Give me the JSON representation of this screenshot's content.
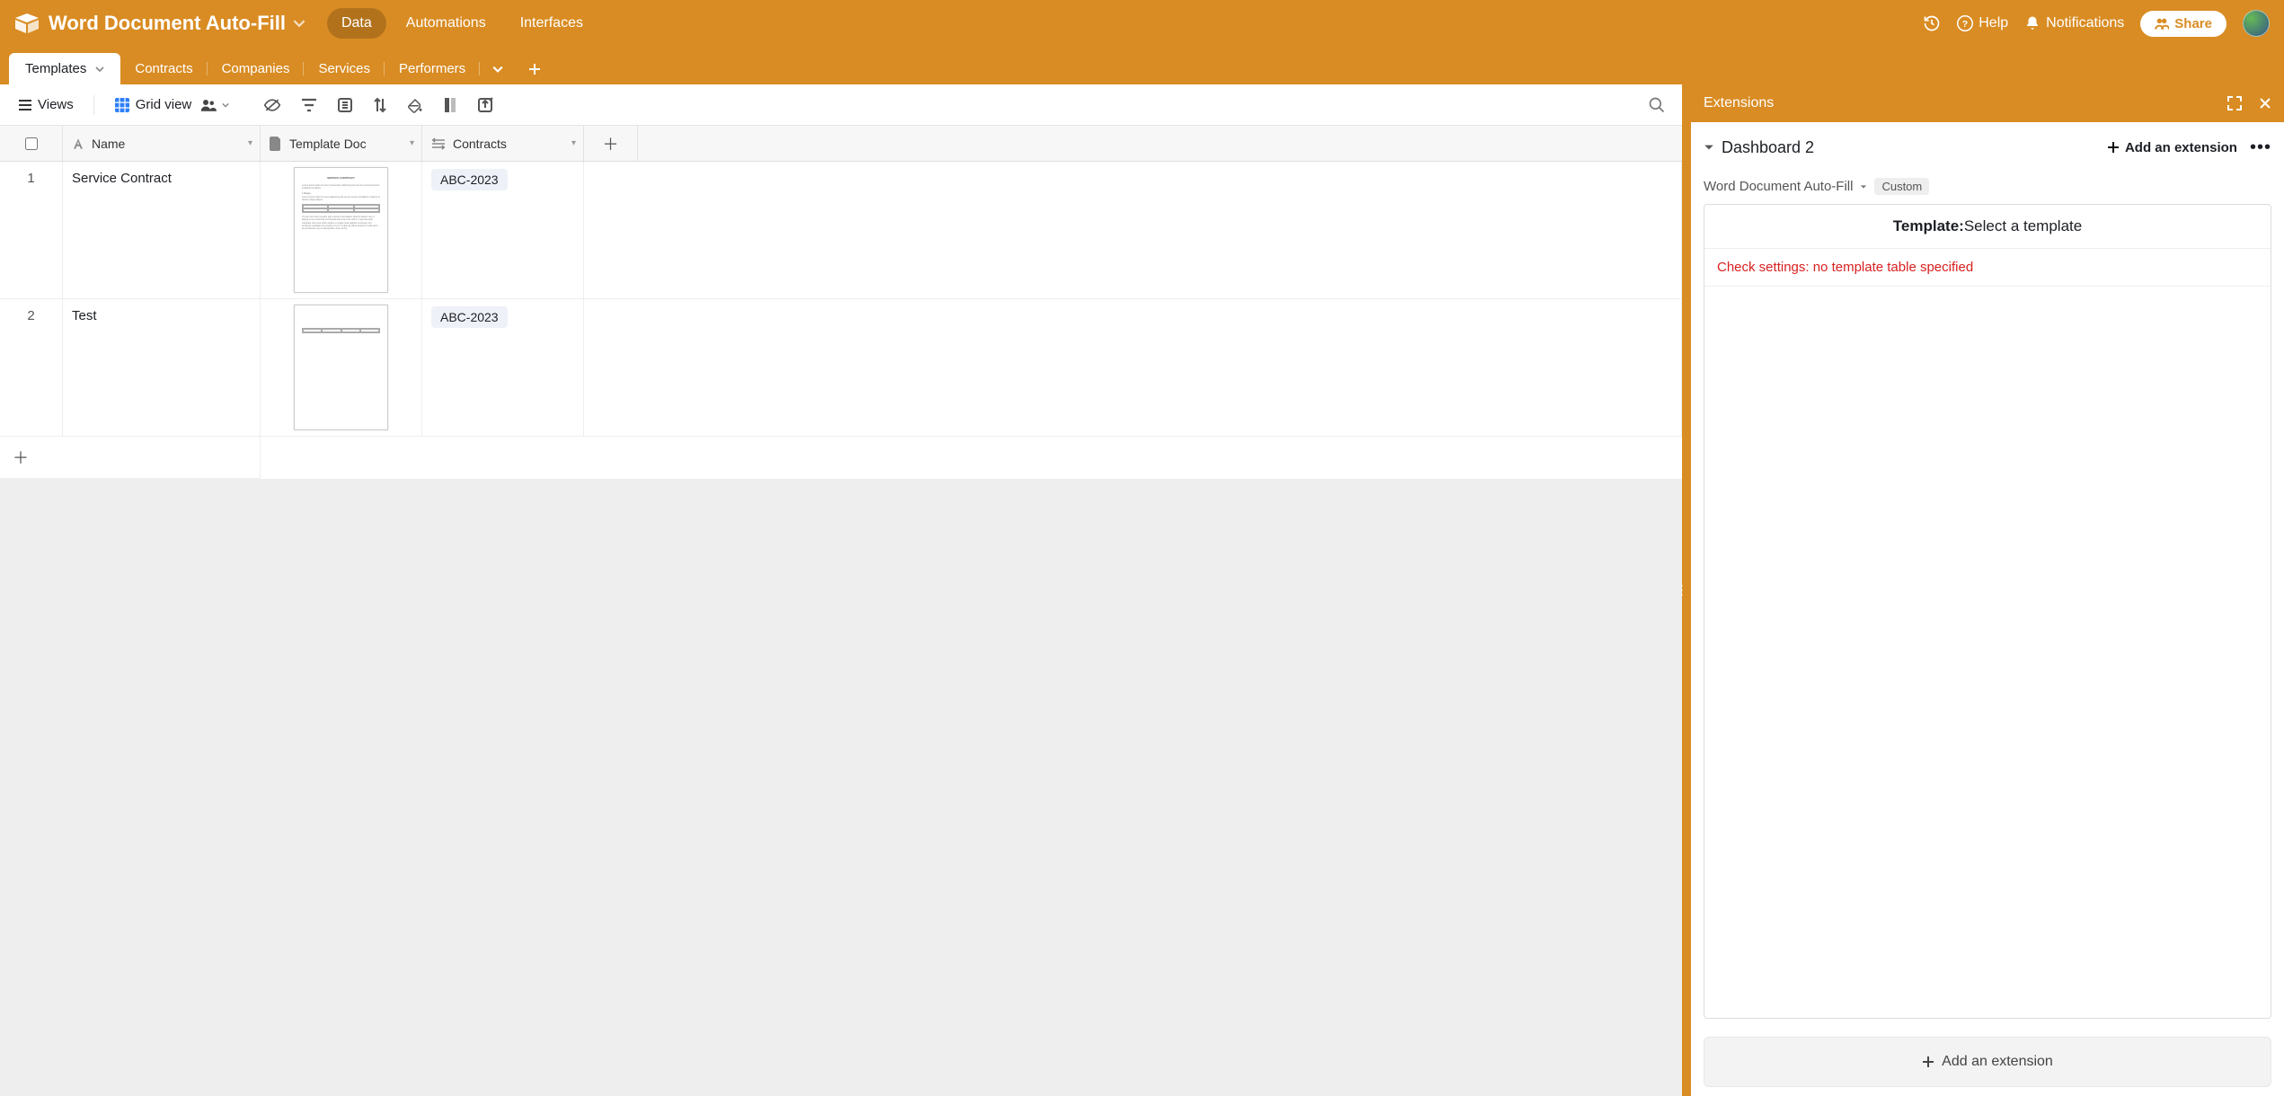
{
  "header": {
    "base_name": "Word Document Auto-Fill",
    "nav": [
      "Data",
      "Automations",
      "Interfaces"
    ],
    "nav_active_index": 0,
    "help": "Help",
    "notifications": "Notifications",
    "share": "Share"
  },
  "tables": {
    "active": "Templates",
    "others": [
      "Contracts",
      "Companies",
      "Services",
      "Performers"
    ]
  },
  "view_toolbar": {
    "views": "Views",
    "grid_view": "Grid view"
  },
  "columns": [
    "Name",
    "Template Doc",
    "Contracts"
  ],
  "rows": [
    {
      "num": "1",
      "name": "Service Contract",
      "contract": "ABC-2023",
      "doc_style": "full"
    },
    {
      "num": "2",
      "name": "Test",
      "contract": "ABC-2023",
      "doc_style": "sparse"
    }
  ],
  "extensions": {
    "panel_title": "Extensions",
    "dashboard": "Dashboard 2",
    "add_extension": "Add an extension",
    "ext_name": "Word Document Auto-Fill",
    "badge": "Custom",
    "template_label": "Template:",
    "template_prompt": "Select a template",
    "error": "Check settings: no template table specified",
    "add_extension_big": "Add an extension"
  }
}
